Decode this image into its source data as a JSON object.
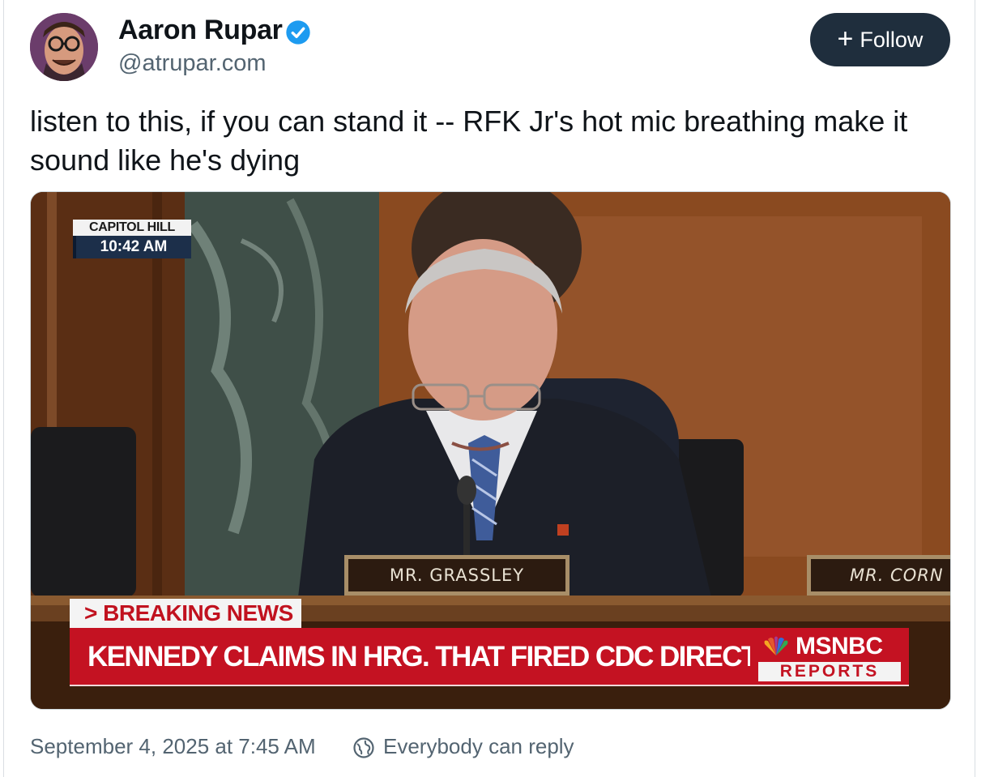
{
  "author": {
    "name": "Aaron Rupar",
    "handle": "@atrupar.com",
    "verified": true
  },
  "follow_button": {
    "label": "Follow",
    "icon": "plus-icon"
  },
  "post": {
    "text": "listen to this, if you can stand it -- RFK Jr's hot mic breathing make it sound like he's dying"
  },
  "video": {
    "location_bug": "CAPITOL HILL",
    "time_bug": "10:42 AM",
    "nameplate_main": "MR. GRASSLEY",
    "nameplate_side": "MR. CORN",
    "breaking_label": "> BREAKING NEWS",
    "headline": "KENNEDY CLAIMS IN HRG. THAT FIRED CDC DIRECTOR IS LYING",
    "network": "MSNBC",
    "network_sub": "REPORTS"
  },
  "footer": {
    "timestamp": "September 4, 2025 at 7:45 AM",
    "reply_icon": "globe-icon",
    "reply_setting": "Everybody can reply"
  },
  "colors": {
    "follow_bg": "#1f2e3d",
    "verified": "#1d9bf0",
    "breaking_red": "#c41222",
    "secondary_text": "#536471"
  }
}
